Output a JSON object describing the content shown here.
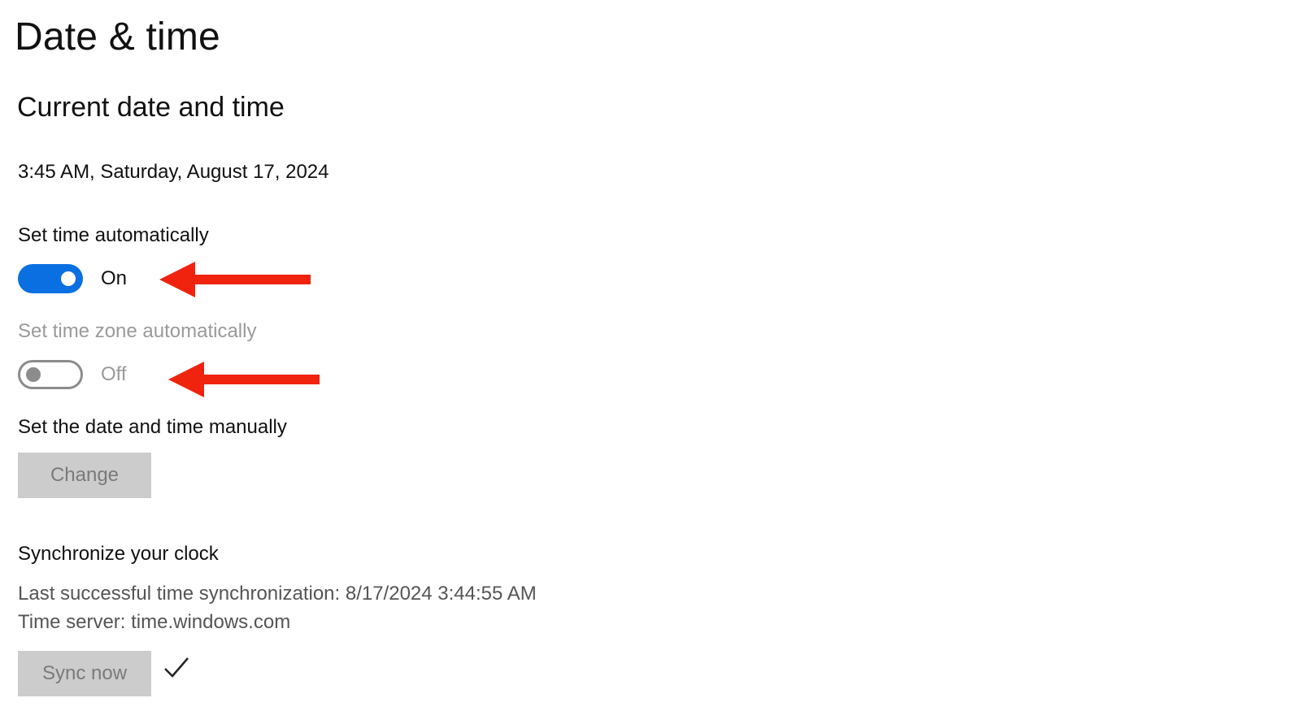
{
  "page": {
    "title": "Date & time"
  },
  "current": {
    "heading": "Current date and time",
    "datetime": "3:45 AM, Saturday, August 17, 2024"
  },
  "auto_time": {
    "label": "Set time automatically",
    "state": "On",
    "enabled": true
  },
  "auto_timezone": {
    "label": "Set time zone automatically",
    "state": "Off",
    "enabled": false
  },
  "manual": {
    "label": "Set the date and time manually",
    "button": "Change"
  },
  "sync": {
    "heading": "Synchronize your clock",
    "last_sync": "Last successful time synchronization: 8/17/2024 3:44:55 AM",
    "server": "Time server: time.windows.com",
    "button": "Sync now",
    "status_icon": "checkmark-icon"
  },
  "colors": {
    "accent": "#0a6fe0",
    "annotation_arrow": "#f0230f",
    "disabled_text": "#9a9a9a",
    "button_bg": "#cccccc"
  },
  "annotations": {
    "arrow_icon": "left-arrow-icon"
  }
}
